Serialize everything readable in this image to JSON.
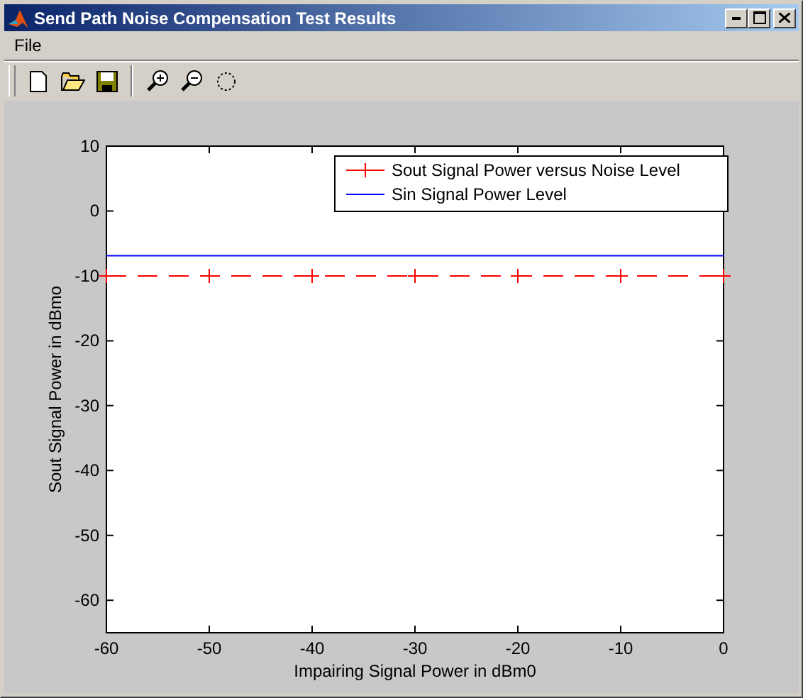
{
  "window": {
    "title": "Send Path Noise Compensation Test Results"
  },
  "menu": [
    {
      "label": "File"
    }
  ],
  "figure": {
    "chart_data": {
      "type": "line",
      "xlabel": "Impairing Signal Power in dBm0",
      "ylabel": "Sout Signal Power in dBmo",
      "x": [
        -60,
        -50,
        -40,
        -30,
        -20,
        -10,
        0
      ],
      "xlim": [
        -60,
        0
      ],
      "ylim": [
        -65,
        10
      ],
      "xticks": [
        -60,
        -50,
        -40,
        -30,
        -20,
        -10,
        0
      ],
      "yticks": [
        10,
        0,
        -10,
        -20,
        -30,
        -40,
        -50,
        -60
      ],
      "legend": true,
      "series": [
        {
          "name": "Sout Signal Power versus Noise Level",
          "color": "#ff0000",
          "line_style": "dashed",
          "marker": "+",
          "values": [
            -10,
            -10,
            -10,
            -10,
            -10,
            -10,
            -10
          ]
        },
        {
          "name": "Sin Signal Power Level",
          "color": "#0000ff",
          "line_style": "solid",
          "values": [
            -6.9,
            -6.9,
            -6.9,
            -6.9,
            -6.9,
            -6.9,
            -6.9
          ]
        }
      ]
    }
  }
}
